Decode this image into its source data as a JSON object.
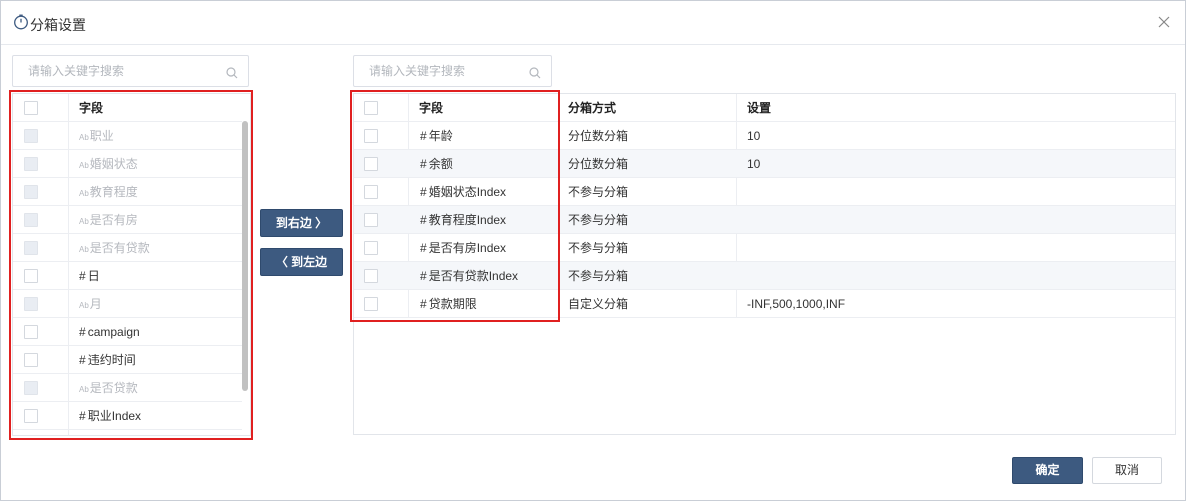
{
  "dialog": {
    "title": "分箱设置",
    "icon": "timer-icon",
    "close_icon": "close-icon"
  },
  "left": {
    "search_placeholder": "请输入关键字搜索",
    "header": "字段",
    "type_prefix_text": "Ab",
    "type_prefix_num": "#",
    "items": [
      {
        "label": "职业",
        "type": "text",
        "disabled": true
      },
      {
        "label": "婚姻状态",
        "type": "text",
        "disabled": true
      },
      {
        "label": "教育程度",
        "type": "text",
        "disabled": true
      },
      {
        "label": "是否有房",
        "type": "text",
        "disabled": true
      },
      {
        "label": "是否有贷款",
        "type": "text",
        "disabled": true
      },
      {
        "label": "日",
        "type": "num",
        "disabled": false
      },
      {
        "label": "月",
        "type": "text",
        "disabled": true
      },
      {
        "label": "campaign",
        "type": "num",
        "disabled": false
      },
      {
        "label": "违约时间",
        "type": "num",
        "disabled": false
      },
      {
        "label": "是否贷款",
        "type": "text",
        "disabled": true
      },
      {
        "label": "职业Index",
        "type": "num",
        "disabled": false
      }
    ]
  },
  "move": {
    "to_right": "到右边 〉",
    "to_left": "〈 到左边"
  },
  "right": {
    "search_placeholder": "请输入关键字搜索",
    "headers": {
      "field": "字段",
      "method": "分箱方式",
      "setting": "设置"
    },
    "rows": [
      {
        "field": "年龄",
        "method": "分位数分箱",
        "setting": "10"
      },
      {
        "field": "余额",
        "method": "分位数分箱",
        "setting": "10"
      },
      {
        "field": "婚姻状态Index",
        "method": "不参与分箱",
        "setting": ""
      },
      {
        "field": "教育程度Index",
        "method": "不参与分箱",
        "setting": ""
      },
      {
        "field": "是否有房Index",
        "method": "不参与分箱",
        "setting": ""
      },
      {
        "field": "是否有贷款Index",
        "method": "不参与分箱",
        "setting": ""
      },
      {
        "field": "贷款期限",
        "method": "自定义分箱",
        "setting": "-INF,500,1000,INF"
      }
    ]
  },
  "footer": {
    "ok": "确定",
    "cancel": "取消"
  },
  "colors": {
    "primary": "#3d5a80",
    "highlight_box": "#e02020",
    "alt_row": "#f5f7fa"
  }
}
